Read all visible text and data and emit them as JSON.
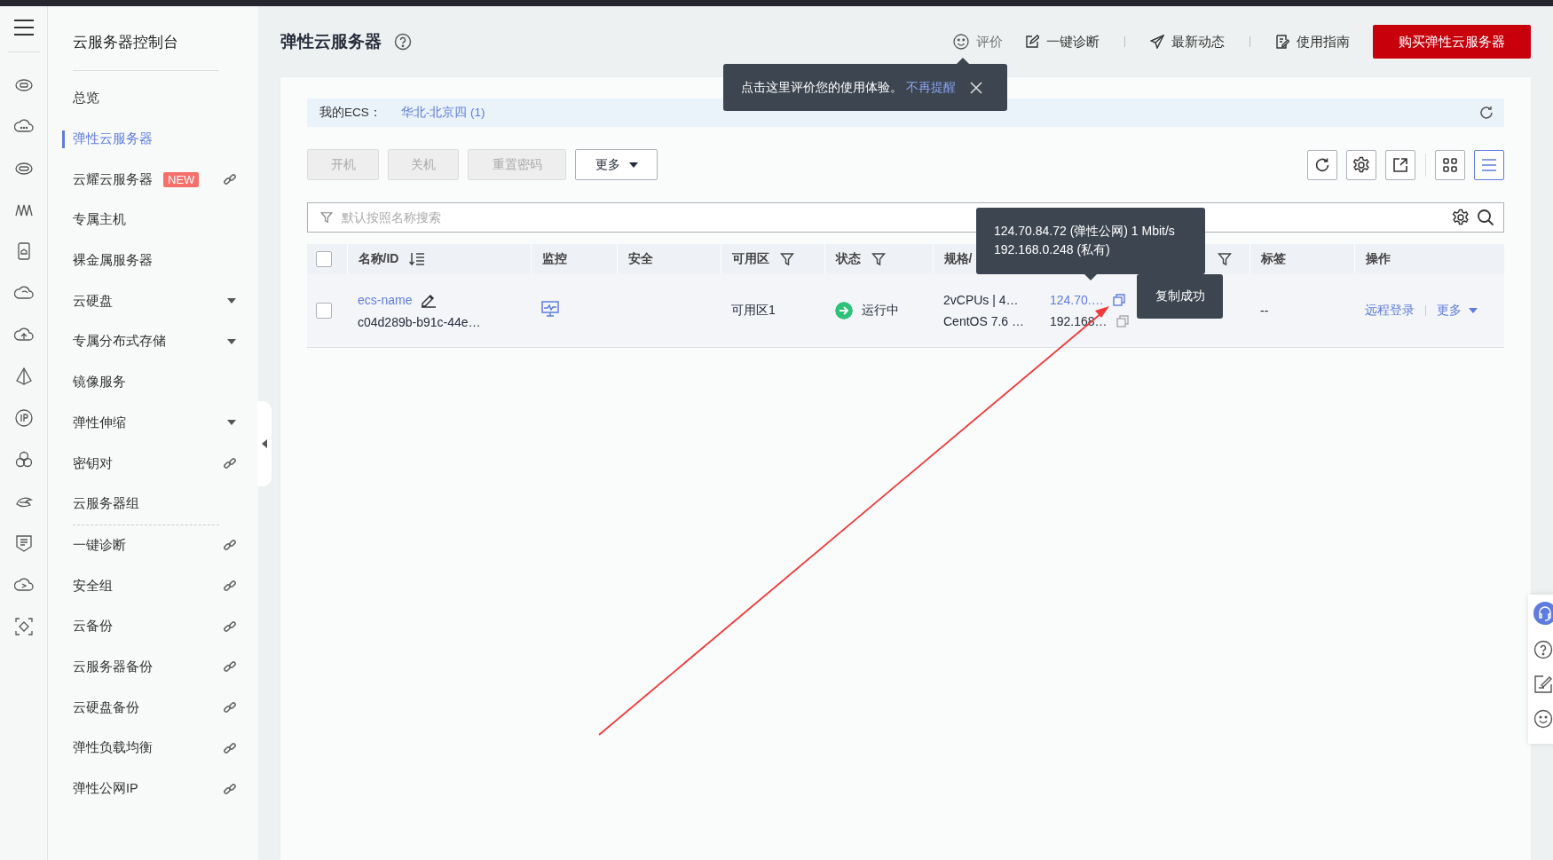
{
  "sidebar": {
    "title": "云服务器控制台",
    "items": [
      {
        "label": "总览",
        "kind": "plain",
        "selected": false
      },
      {
        "label": "弹性云服务器",
        "kind": "plain",
        "selected": true
      },
      {
        "label": "云耀云服务器",
        "kind": "link",
        "selected": false,
        "badge": "NEW"
      },
      {
        "label": "专属主机",
        "kind": "plain",
        "selected": false
      },
      {
        "label": "裸金属服务器",
        "kind": "plain",
        "selected": false
      },
      {
        "label": "云硬盘",
        "kind": "group",
        "selected": false
      },
      {
        "label": "专属分布式存储",
        "kind": "group",
        "selected": false
      },
      {
        "label": "镜像服务",
        "kind": "plain",
        "selected": false
      },
      {
        "label": "弹性伸缩",
        "kind": "group",
        "selected": false
      },
      {
        "label": "密钥对",
        "kind": "link",
        "selected": false
      },
      {
        "label": "云服务器组",
        "kind": "plain",
        "selected": false
      }
    ],
    "tools": [
      {
        "label": "一键诊断",
        "kind": "link",
        "selected": false
      },
      {
        "label": "安全组",
        "kind": "link",
        "selected": false
      },
      {
        "label": "云备份",
        "kind": "link",
        "selected": false
      },
      {
        "label": "云服务器备份",
        "kind": "link",
        "selected": false
      },
      {
        "label": "云硬盘备份",
        "kind": "link",
        "selected": false
      },
      {
        "label": "弹性负载均衡",
        "kind": "link",
        "selected": false
      },
      {
        "label": "弹性公网IP",
        "kind": "link",
        "selected": false
      }
    ]
  },
  "header": {
    "title": "弹性云服务器",
    "links": [
      {
        "label": "评价",
        "kind": "smile"
      },
      {
        "label": "一键诊断",
        "kind": "edit"
      },
      {
        "label": "最新动态",
        "kind": "send"
      },
      {
        "label": "使用指南",
        "kind": "guide"
      }
    ],
    "buy_button": "购买弹性云服务器"
  },
  "region_bar": {
    "label": "我的ECS：",
    "region": "华北-北京四 (1)"
  },
  "actions": [
    {
      "label": "开机",
      "disabled": true
    },
    {
      "label": "关机",
      "disabled": true
    },
    {
      "label": "重置密码",
      "disabled": true
    },
    {
      "label": "更多",
      "disabled": false,
      "kind": "dropdown"
    }
  ],
  "view_toggle": [
    {
      "kind": "grid",
      "selected": false
    },
    {
      "kind": "list",
      "selected": true
    }
  ],
  "search": {
    "placeholder": "默认按照名称搜索"
  },
  "table": {
    "select_all": {
      "checked": false
    },
    "columns": [
      {
        "label": "名称/ID",
        "kind": "sort"
      },
      {
        "label": "监控"
      },
      {
        "label": "安全"
      },
      {
        "label": "可用区",
        "kind": "filter"
      },
      {
        "label": "状态",
        "kind": "filter"
      },
      {
        "label": "规格/"
      },
      {
        "kind": "blank"
      },
      {
        "kind": "filter"
      },
      {
        "label": "标签"
      },
      {
        "label": "操作"
      }
    ],
    "rows": [
      {
        "checked": false,
        "name": "ecs-name",
        "id": "c04d289b-b91c-44e…",
        "zone": "可用区1",
        "status": "运行中",
        "color": "#2cc279",
        "spec": "2vCPUs | 4…",
        "image": "CentOS 7.6 …",
        "public_ip": "124.70.…",
        "private_ip": "192.168…",
        "tag": "--",
        "actions": [
          "远程登录",
          "更多"
        ]
      }
    ]
  },
  "notice_tooltip": {
    "text": "点击这里评价您的使用体验。",
    "link": "不再提醒"
  },
  "ip_tooltip": {
    "lines": [
      "124.70.84.72 (弹性公网) 1 Mbit/s",
      "192.168.0.248 (私有)"
    ]
  },
  "copy_tooltip": {
    "text": "复制成功"
  }
}
